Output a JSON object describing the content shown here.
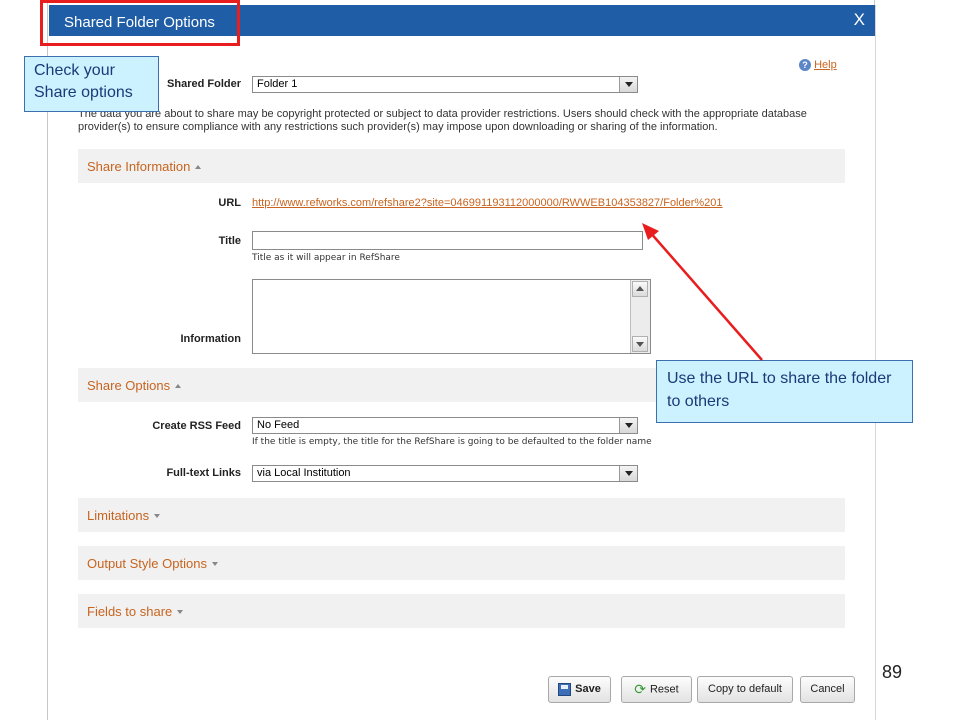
{
  "dialog": {
    "title": "Shared Folder Options",
    "close_label": "X",
    "help_label": "Help",
    "shared_folder_label": "Shared Folder",
    "shared_folder_value": "Folder 1",
    "disclaimer": "The data you are about to share may be copyright protected or subject to data provider restrictions. Users should check with the appropriate database provider(s) to ensure compliance with any restrictions such provider(s) may impose upon downloading or sharing of the information."
  },
  "share_information": {
    "heading": "Share Information",
    "url_label": "URL",
    "url_value": "http://www.refworks.com/refshare2?site=046991193112000000/RWWEB104353827/Folder%201",
    "title_label": "Title",
    "title_value": "",
    "title_hint": "Title as it will appear in RefShare",
    "information_label": "Information",
    "information_value": ""
  },
  "share_options": {
    "heading": "Share Options",
    "rss_label": "Create RSS Feed",
    "rss_value": "No Feed",
    "rss_hint": "If the title is empty, the title for the RefShare is going to be defaulted to the folder name",
    "fulltext_label": "Full-text Links",
    "fulltext_value": "via Local Institution"
  },
  "collapsed_sections": {
    "limitations": "Limitations",
    "output_style": "Output Style Options",
    "fields": "Fields to share"
  },
  "buttons": {
    "save": "Save",
    "reset": "Reset",
    "copy": "Copy to default",
    "cancel": "Cancel"
  },
  "annotations": {
    "check_options": "Check your Share options",
    "use_url": "Use the URL to share the folder to others"
  },
  "slide_number": "89",
  "colors": {
    "titlebar": "#1f5da6",
    "link_orange": "#c8641f",
    "callout_fill": "#ccf2ff",
    "highlight_red": "#e81e1e"
  }
}
